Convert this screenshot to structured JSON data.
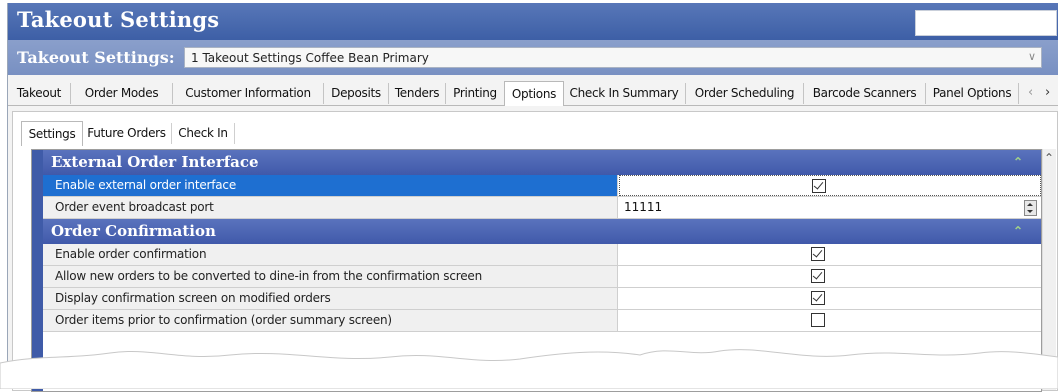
{
  "window": {
    "title": "Takeout Settings"
  },
  "selector": {
    "label": "Takeout Settings:",
    "value": "1 Takeout Settings Coffee Bean Primary"
  },
  "tabs": [
    {
      "label": "Takeout",
      "active": false
    },
    {
      "label": "Order Modes",
      "active": false
    },
    {
      "label": "Customer Information",
      "active": false
    },
    {
      "label": "Deposits",
      "active": false
    },
    {
      "label": "Tenders",
      "active": false
    },
    {
      "label": "Printing",
      "active": false
    },
    {
      "label": "Options",
      "active": true
    },
    {
      "label": "Check In Summary",
      "active": false
    },
    {
      "label": "Order Scheduling",
      "active": false
    },
    {
      "label": "Barcode Scanners",
      "active": false
    },
    {
      "label": "Panel Options",
      "active": false
    }
  ],
  "subtabs": [
    {
      "label": "Settings",
      "active": true
    },
    {
      "label": "Future Orders",
      "active": false
    },
    {
      "label": "Check In",
      "active": false
    }
  ],
  "sections": [
    {
      "title": "External Order Interface",
      "rows": [
        {
          "label": "Enable external order interface",
          "type": "checkbox",
          "checked": true,
          "selected": true
        },
        {
          "label": "Order event broadcast port",
          "type": "spinner",
          "value": "11111"
        }
      ]
    },
    {
      "title": "Order Confirmation",
      "rows": [
        {
          "label": "Enable order confirmation",
          "type": "checkbox",
          "checked": true
        },
        {
          "label": "Allow new orders to be converted to dine-in from the confirmation screen",
          "type": "checkbox",
          "checked": true
        },
        {
          "label": "Display confirmation screen on modified orders",
          "type": "checkbox",
          "checked": true
        },
        {
          "label": "Order items prior to confirmation (order summary screen)",
          "type": "checkbox",
          "checked": false
        }
      ]
    }
  ],
  "colors": {
    "title_bar": "#3d5fa6",
    "section_header": "#4059aa",
    "selected_row": "#1e6fd1"
  }
}
